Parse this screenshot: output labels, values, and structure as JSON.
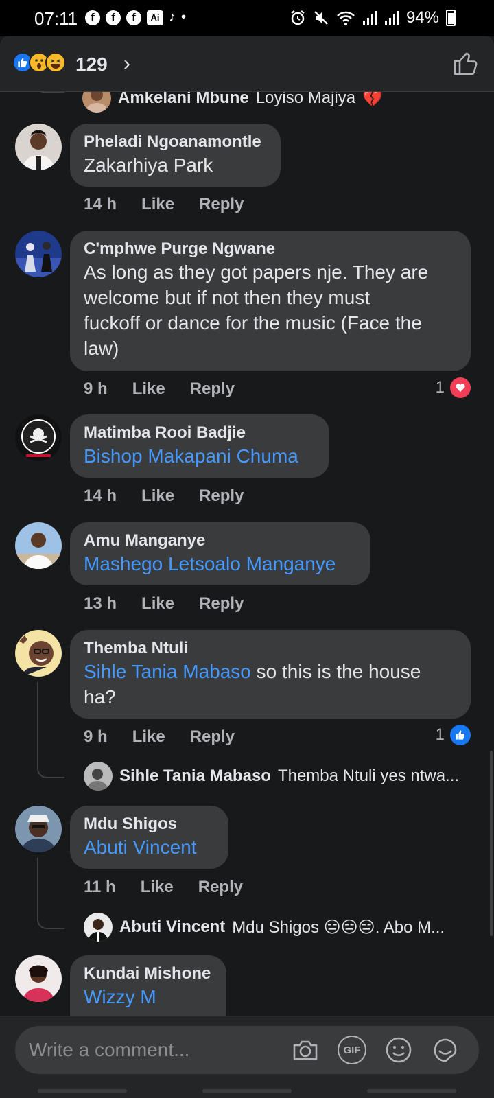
{
  "status_bar": {
    "time": "07:11",
    "ai_label": "Ai",
    "tiktok_glyph": "♪",
    "dot": "•",
    "alarm_glyph": "⏰",
    "mute_glyph": "🔇",
    "wifi_glyph": "📶",
    "battery": "94%"
  },
  "header": {
    "reaction_count": "129",
    "chevron": "›",
    "reactions": [
      "like-icon",
      "wow-icon",
      "haha-icon"
    ]
  },
  "partial_reply": {
    "name": "Amkelani Mbune",
    "text": "Loyiso Majiya",
    "emoji": "💔"
  },
  "comments": [
    {
      "author": "Pheladi Ngoanamontle",
      "text": "Zakarhiya Park",
      "time": "14 h",
      "like": "Like",
      "reply": "Reply"
    },
    {
      "author": "C'mphwe Purge Ngwane",
      "lines": [
        "As long as they got papers nje.  They are",
        "welcome but if not then they must",
        "fuckoff or dance for the music  (Face the",
        "law)"
      ],
      "time": "9 h",
      "like": "Like",
      "reply": "Reply",
      "reaction_count": "1"
    },
    {
      "author": "Matimba Rooi Badjie",
      "mention": "Bishop Makapani Chuma",
      "time": "14 h",
      "like": "Like",
      "reply": "Reply"
    },
    {
      "author": "Amu Manganye",
      "mention": "Mashego Letsoalo Manganye",
      "time": "13 h",
      "like": "Like",
      "reply": "Reply"
    },
    {
      "author": "Themba Ntuli",
      "mention": "Sihle Tania Mabaso",
      "text_after": " so this is the house",
      "line2": "ha?",
      "time": "9 h",
      "like": "Like",
      "reply": "Reply",
      "reaction_count": "1",
      "reply_preview": {
        "name": "Sihle Tania Mabaso",
        "text": "Themba Ntuli yes ntwa..."
      }
    },
    {
      "author": "Mdu Shigos",
      "mention": "Abuti Vincent",
      "time": "11 h",
      "like": "Like",
      "reply": "Reply",
      "reply_preview": {
        "name": "Abuti Vincent",
        "text": "Mdu Shigos 😑😑😑. Abo M..."
      }
    },
    {
      "author": "Kundai Mishone",
      "mention": "Wizzy M"
    }
  ],
  "composer": {
    "placeholder": "Write a comment...",
    "gif_label": "GIF"
  },
  "colors": {
    "background": "#18191a",
    "bubble": "#3a3b3c",
    "mention": "#4599ff",
    "like_blue": "#1877f2",
    "heart_red": "#f33e58"
  }
}
